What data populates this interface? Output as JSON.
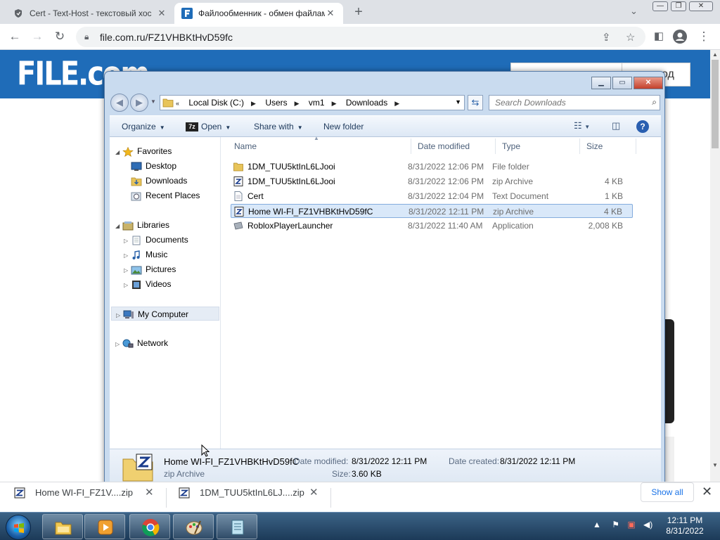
{
  "browser": {
    "tabs": [
      {
        "title": "Cert - Text-Host - текстовый хос",
        "active": false
      },
      {
        "title": "Файлообменник - обмен файлами",
        "active": true
      }
    ],
    "url": "file.com.ru/FZ1VHBKtHvD59fc"
  },
  "website": {
    "logo_text": "FILE.com.",
    "header_button": "од",
    "brand_color": "#1f6cb8"
  },
  "explorer": {
    "breadcrumb": [
      "Local Disk (C:)",
      "Users",
      "vm1",
      "Downloads"
    ],
    "search_placeholder": "Search Downloads",
    "commands": {
      "organize": "Organize",
      "open": "Open",
      "share_with": "Share with",
      "new_folder": "New folder"
    },
    "nav": {
      "favorites": "Favorites",
      "desktop": "Desktop",
      "downloads": "Downloads",
      "recent_places": "Recent Places",
      "libraries": "Libraries",
      "documents": "Documents",
      "music": "Music",
      "pictures": "Pictures",
      "videos": "Videos",
      "my_computer": "My Computer",
      "network": "Network"
    },
    "columns": {
      "name": "Name",
      "date": "Date modified",
      "type": "Type",
      "size": "Size"
    },
    "files": [
      {
        "name": "1DM_TUU5ktInL6LJooi",
        "date": "8/31/2022 12:06 PM",
        "type": "File folder",
        "size": "",
        "icon": "folder-icon"
      },
      {
        "name": "1DM_TUU5ktInL6LJooi",
        "date": "8/31/2022 12:06 PM",
        "type": "zip Archive",
        "size": "4 KB",
        "icon": "zip-icon"
      },
      {
        "name": "Cert",
        "date": "8/31/2022 12:04 PM",
        "type": "Text Document",
        "size": "1 KB",
        "icon": "text-file-icon"
      },
      {
        "name": "Home WI-FI_FZ1VHBKtHvD59fC",
        "date": "8/31/2022 12:11 PM",
        "type": "zip Archive",
        "size": "4 KB",
        "icon": "zip-icon",
        "selected": true
      },
      {
        "name": "RobloxPlayerLauncher",
        "date": "8/31/2022 11:40 AM",
        "type": "Application",
        "size": "2,008 KB",
        "icon": "app-icon"
      }
    ],
    "details": {
      "name": "Home WI-FI_FZ1VHBKtHvD59fC",
      "type": "zip Archive",
      "date_modified_label": "Date modified:",
      "date_modified": "8/31/2022 12:11 PM",
      "date_created_label": "Date created:",
      "date_created": "8/31/2022 12:11 PM",
      "size_label": "Size:",
      "size": "3.60 KB"
    }
  },
  "downloads_bar": {
    "items": [
      {
        "name": "Home WI-FI_FZ1V....zip"
      },
      {
        "name": "1DM_TUU5ktInL6LJ....zip"
      }
    ],
    "show_all": "Show all"
  },
  "taskbar": {
    "time": "12:11 PM",
    "date": "8/31/2022"
  }
}
